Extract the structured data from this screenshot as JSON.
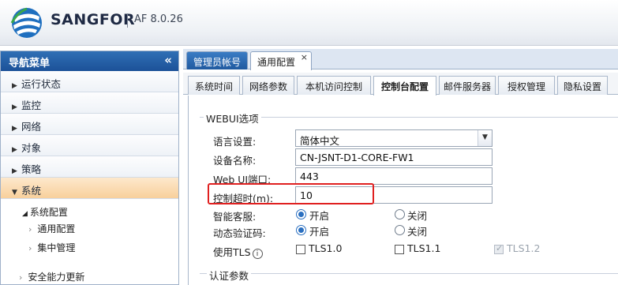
{
  "header": {
    "brand": "SANGFOR",
    "version": "AF 8.0.26"
  },
  "sidebar": {
    "title": "导航菜单",
    "collapse_glyph": "«",
    "items": [
      {
        "label": "运行状态",
        "arrow": "▶"
      },
      {
        "label": "监控",
        "arrow": "▶"
      },
      {
        "label": "网络",
        "arrow": "▶"
      },
      {
        "label": "对象",
        "arrow": "▶"
      },
      {
        "label": "策略",
        "arrow": "▶"
      },
      {
        "label": "系统",
        "arrow": "▼"
      }
    ],
    "sub_group": "系统配置",
    "leaves": [
      "通用配置",
      "集中管理"
    ],
    "next_item": "安全能力更新"
  },
  "top_tabs": [
    {
      "label": "管理员帐号",
      "active": false
    },
    {
      "label": "通用配置",
      "active": true,
      "close": "×"
    }
  ],
  "sub_tabs": [
    "系统时间",
    "网络参数",
    "本机访问控制",
    "控制台配置",
    "邮件服务器",
    "授权管理",
    "隐私设置"
  ],
  "active_sub_tab": "控制台配置",
  "form": {
    "section_title": "WEBUI选项",
    "language_label": "语言设置:",
    "language_value": "简体中文",
    "device_name_label": "设备名称:",
    "device_name_value": "CN-JSNT-D1-CORE-FW1",
    "webui_port_label": "Web UI端口:",
    "webui_port_value": "443",
    "timeout_label": "控制超时(m):",
    "timeout_value": "10",
    "smart_cs_label": "智能客服:",
    "dyn_code_label": "动态验证码:",
    "on_label": "开启",
    "off_label": "关闭",
    "tls_label": "使用TLS",
    "info_glyph": "i",
    "tls_options": [
      "TLS1.0",
      "TLS1.1",
      "TLS1.2"
    ],
    "auth_section_title": "认证参数"
  },
  "colors": {
    "accent": "#1c5198",
    "highlight": "#e02020",
    "active_nav": "#f8d09c"
  }
}
